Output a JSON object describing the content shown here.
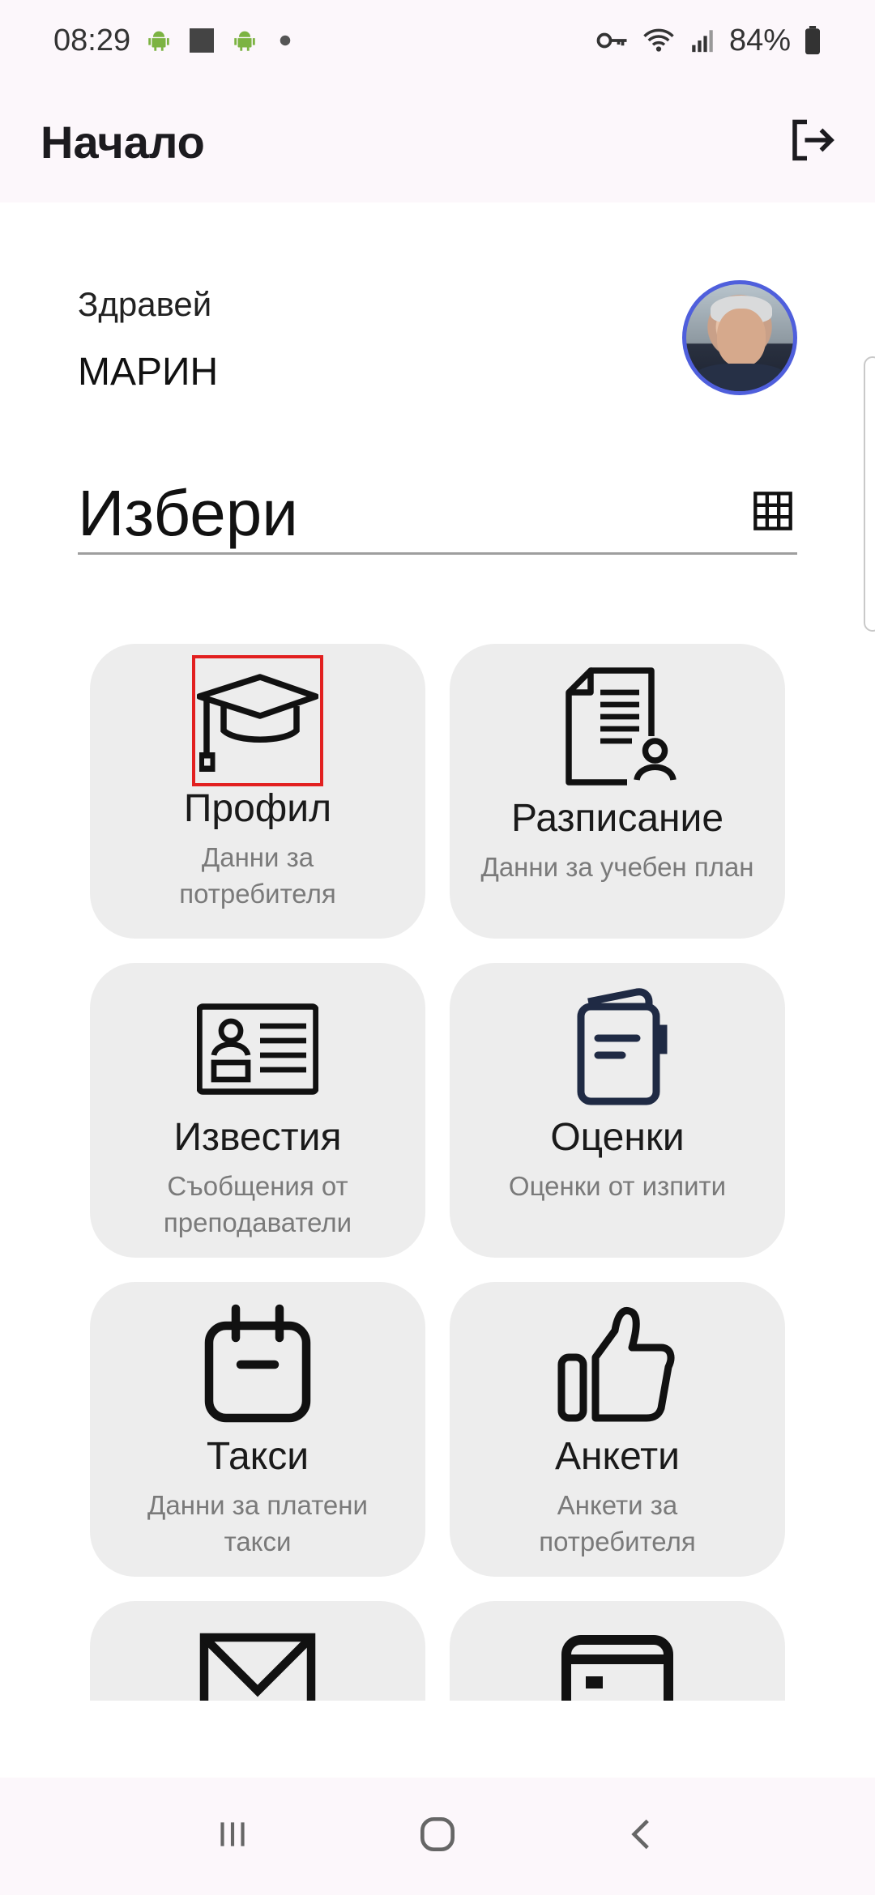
{
  "status_bar": {
    "time": "08:29",
    "battery": "84%",
    "icons": [
      "android-icon",
      "square-notification-icon",
      "android-icon",
      "dot-icon",
      "key-icon",
      "wifi-icon",
      "signal-icon",
      "battery-icon"
    ]
  },
  "app_bar": {
    "title": "Начало",
    "logout_icon": "logout-icon"
  },
  "greeting": {
    "hello": "Здравей",
    "name": "МАРИН"
  },
  "section": {
    "title": "Избери",
    "view_icon": "grid-view-icon"
  },
  "tiles": [
    {
      "title": "Профил",
      "subtitle": "Данни за потребителя",
      "icon": "graduation-cap-icon"
    },
    {
      "title": "Разписание",
      "subtitle": "Данни за учебен план",
      "icon": "document-user-icon"
    },
    {
      "title": "Известия",
      "subtitle": "Съобщения от преподаватели",
      "icon": "id-card-icon"
    },
    {
      "title": "Оценки",
      "subtitle": "Оценки от изпити",
      "icon": "notebook-icon"
    },
    {
      "title": "Такси",
      "subtitle": "Данни за платени такси",
      "icon": "calendar-icon"
    },
    {
      "title": "Анкети",
      "subtitle": "Анкети за потребителя",
      "icon": "thumbs-up-icon"
    },
    {
      "title": "",
      "subtitle": "",
      "icon": "envelope-icon"
    },
    {
      "title": "",
      "subtitle": "",
      "icon": "card-icon"
    }
  ],
  "colors": {
    "appbar_bg": "#fcf7fb",
    "tile_bg": "#ededed",
    "avatar_ring": "#4f5fdc",
    "highlight": "#e22020",
    "notebook_icon": "#1f2a44"
  },
  "nav_bar": {
    "icons": [
      "recent-apps-icon",
      "home-icon",
      "back-icon"
    ]
  }
}
